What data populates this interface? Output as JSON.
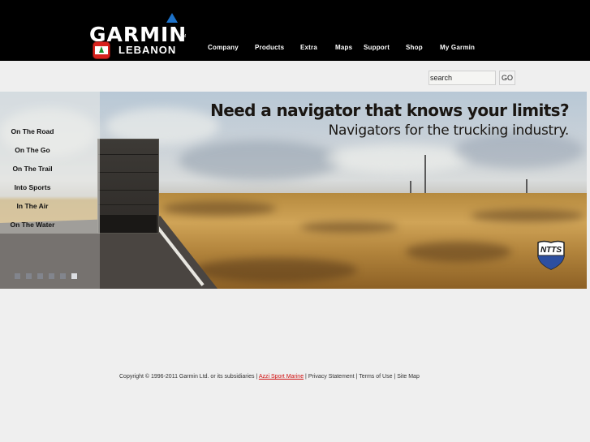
{
  "header": {
    "brand": "GARMIN",
    "brand_tm": "TM",
    "region": "LEBANON",
    "brand_color": "#1d72c9",
    "nav": [
      {
        "label": "Company"
      },
      {
        "label": "Products"
      },
      {
        "label": "Extra"
      },
      {
        "label": "Maps"
      },
      {
        "label": "Support"
      },
      {
        "label": "Shop"
      },
      {
        "label": "My Garmin"
      }
    ]
  },
  "search": {
    "value": "search",
    "button_label": "GO"
  },
  "hero": {
    "headline": "Need a navigator that knows your limits?",
    "subline": "Navigators for the trucking industry.",
    "badge_text": "NTTS",
    "side_menu": [
      {
        "label": "On The Road"
      },
      {
        "label": "On The Go"
      },
      {
        "label": "On The Trail"
      },
      {
        "label": "Into Sports"
      },
      {
        "label": "In The Air"
      },
      {
        "label": "On The Water"
      }
    ],
    "slides": {
      "count": 6,
      "active_index": 5
    }
  },
  "footer": {
    "copyright": "Copyright © 1996-2011 Garmin Ltd. or its subsidiaries",
    "separator": "|",
    "links": [
      {
        "label": "Azzi Sport Marine",
        "color": "#d01010"
      },
      {
        "label": "Privacy Statement"
      },
      {
        "label": "Terms of Use"
      },
      {
        "label": "Site Map"
      }
    ]
  }
}
